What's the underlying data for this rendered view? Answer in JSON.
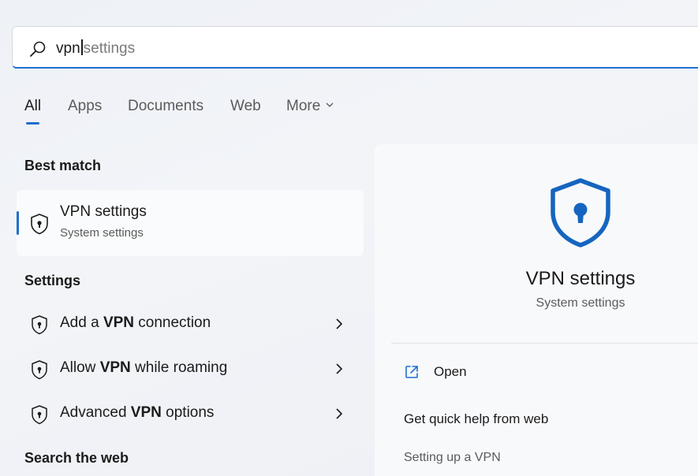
{
  "search": {
    "typed": "vpn",
    "suggestion": "settings"
  },
  "tabs": [
    {
      "label": "All",
      "active": true
    },
    {
      "label": "Apps"
    },
    {
      "label": "Documents"
    },
    {
      "label": "Web"
    },
    {
      "label": "More"
    }
  ],
  "best_match": {
    "section_label": "Best match",
    "title": "VPN settings",
    "subtitle": "System settings",
    "icon": "shield-icon"
  },
  "settings": {
    "section_label": "Settings",
    "items": [
      {
        "prefix": "Add a ",
        "bold": "VPN",
        "suffix": " connection"
      },
      {
        "prefix": "Allow ",
        "bold": "VPN",
        "suffix": " while roaming"
      },
      {
        "prefix": "Advanced ",
        "bold": "VPN",
        "suffix": " options"
      }
    ]
  },
  "search_web": {
    "section_label": "Search the web"
  },
  "preview": {
    "title": "VPN settings",
    "subtitle": "System settings",
    "open_label": "Open",
    "help_label": "Get quick help from web",
    "help_link": "Setting up a VPN"
  },
  "colors": {
    "accent": "#1f6fd0",
    "shield": "#1565c0"
  }
}
